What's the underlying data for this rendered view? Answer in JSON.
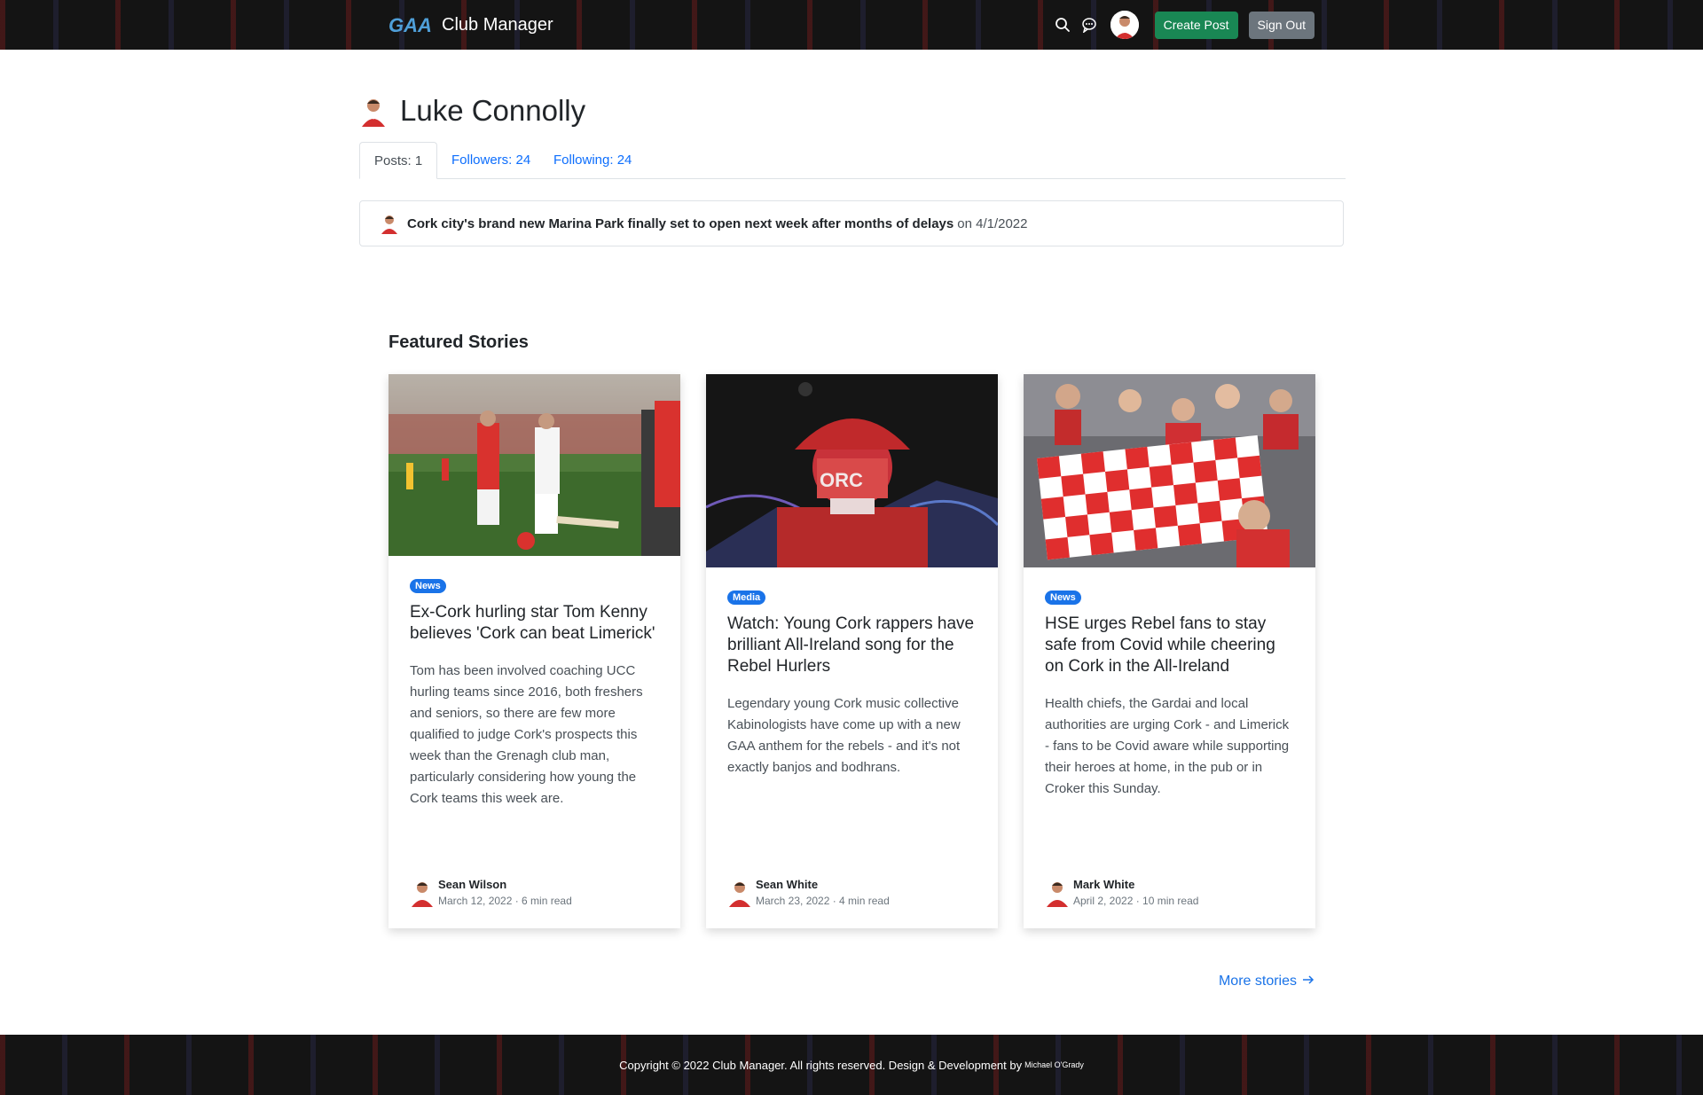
{
  "navbar": {
    "brand_logo_text": "GAA",
    "brand_name": "Club Manager",
    "icons": [
      "search-icon",
      "chat-icon",
      "user-avatar"
    ],
    "create_post_label": "Create Post",
    "sign_out_label": "Sign Out"
  },
  "profile": {
    "name": "Luke Connolly",
    "tabs": [
      {
        "label": "Posts: 1"
      },
      {
        "label": "Followers: 24"
      },
      {
        "label": "Following: 24"
      }
    ],
    "posts": [
      {
        "title": "Cork city's brand new Marina Park finally set to open next week after months of delays",
        "meta": "on 4/1/2022"
      }
    ]
  },
  "featured": {
    "title": "Featured Stories",
    "cards": [
      {
        "badge": "News",
        "title": "Ex-Cork hurling star Tom Kenny believes 'Cork can beat Limerick'",
        "text": "Tom has been involved coaching UCC hurling teams since 2016, both freshers and seniors, so there are few more qualified to judge Cork's prospects this week than the Grenagh club man, particularly considering how young the Cork teams this week are.",
        "author": "Sean Wilson",
        "meta": "March 12, 2022 · 6 min read"
      },
      {
        "badge": "Media",
        "title": "Watch: Young Cork rappers have brilliant All-Ireland song for the Rebel Hurlers",
        "text": "Legendary young Cork music collective Kabinologists have come up with a new GAA anthem for the rebels - and it's not exactly banjos and bodhrans.",
        "author": "Sean White",
        "meta": "March 23, 2022 · 4 min read"
      },
      {
        "badge": "News",
        "title": "HSE urges Rebel fans to stay safe from Covid while cheering on Cork in the All-Ireland",
        "text": "Health chiefs, the Gardai and local authorities are urging Cork - and Limerick - fans to be Covid aware while supporting their heroes at home, in the pub or in Croker this Sunday.",
        "author": "Mark White",
        "meta": "April 2, 2022 · 10 min read"
      }
    ],
    "more_label": "More stories"
  },
  "footer": {
    "text": "Copyright © 2022 Club Manager. All rights reserved. Design & Development by",
    "author": "Michael O'Grady"
  },
  "colors": {
    "primary": "#1a73e8",
    "success": "#198754",
    "secondary": "#6c757d",
    "dark": "#141414"
  }
}
